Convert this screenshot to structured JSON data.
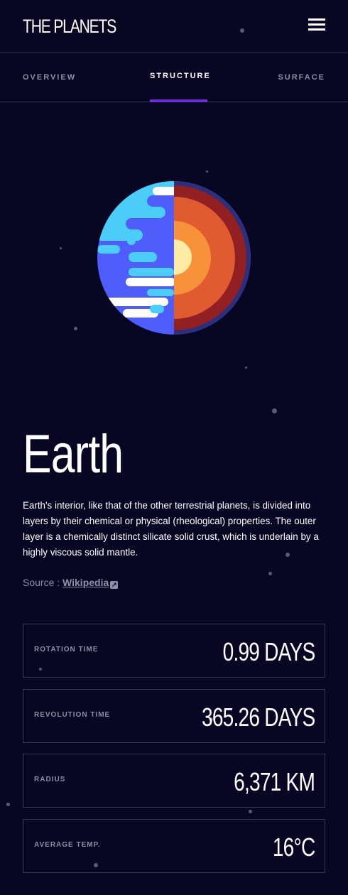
{
  "header": {
    "title": "THE PLANETS",
    "menu_icon": "hamburger-icon"
  },
  "tabs": [
    {
      "label": "OVERVIEW",
      "active": false
    },
    {
      "label": "STRUCTURE",
      "active": true
    },
    {
      "label": "SURFACE",
      "active": false
    }
  ],
  "accent": "#6d2ed5",
  "planet": {
    "name": "Earth",
    "description": "Earth's interior, like that of the other terrestrial planets, is divided into layers by their chemical or physical (rheological) properties. The outer layer is a chemically distinct silicate solid crust, which is underlain by a highly viscous solid mantle.",
    "source_label": "Source : ",
    "source_link": "Wikipedia"
  },
  "stats": [
    {
      "label": "ROTATION TIME",
      "value": "0.99 DAYS"
    },
    {
      "label": "REVOLUTION TIME",
      "value": "365.26 DAYS"
    },
    {
      "label": "RADIUS",
      "value": "6,371 KM"
    },
    {
      "label": "AVERAGE TEMP.",
      "value": "16°C"
    }
  ]
}
